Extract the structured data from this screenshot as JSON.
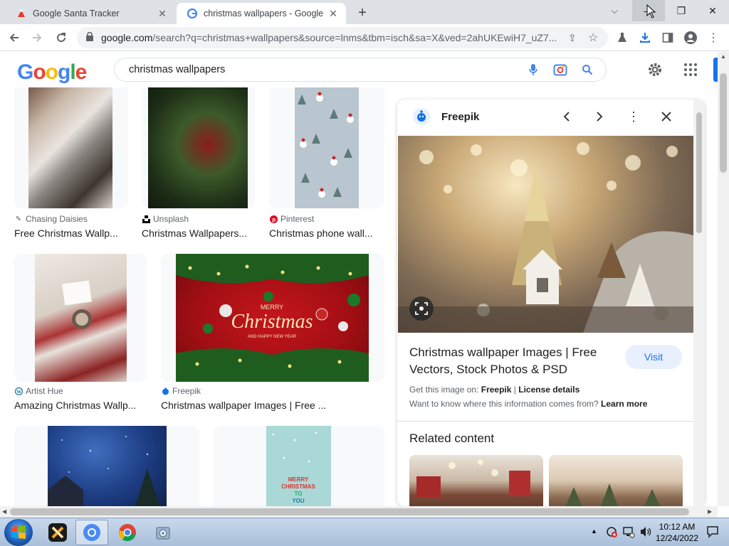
{
  "tabs": [
    {
      "title": "Google Santa Tracker",
      "active": false
    },
    {
      "title": "christmas wallpapers - Google Se",
      "active": true
    }
  ],
  "omnibox": {
    "host": "google.com",
    "path": "/search?q=christmas+wallpapers&source=lnms&tbm=isch&sa=X&ved=2ahUKEwiH7_uZ7..."
  },
  "google": {
    "logo": "Google",
    "query": "christmas wallpapers"
  },
  "results": [
    {
      "source": "Chasing Daisies",
      "title": "Free Christmas Wallp..."
    },
    {
      "source": "Unsplash",
      "title": "Christmas Wallpapers..."
    },
    {
      "source": "Pinterest",
      "title": "Christmas phone wall..."
    },
    {
      "source": "Artist Hue",
      "title": "Amazing Christmas Wallp..."
    },
    {
      "source": "Freepik",
      "title": "Christmas wallpaper Images | Free ..."
    }
  ],
  "panel": {
    "source": "Freepik",
    "title": "Christmas wallpaper Images | Free Vectors, Stock Photos & PSD",
    "visit": "Visit",
    "get_image_prefix": "Get this image on:",
    "get_image_site": "Freepik",
    "license": "License details",
    "info_text": "Want to know where this information comes from?",
    "learn_more": "Learn more",
    "related": "Related content"
  },
  "thumb_text": {
    "merry": "MERRY",
    "christmas": "Christmas",
    "new_year": "AND HAPPY NEW YEAR",
    "card2_line1": "MERRY",
    "card2_line2": "CHRISTMAS",
    "card2_line3": "TO",
    "card2_line4": "YOU"
  },
  "taskbar": {
    "time": "10:12 AM",
    "date": "12/24/2022"
  }
}
